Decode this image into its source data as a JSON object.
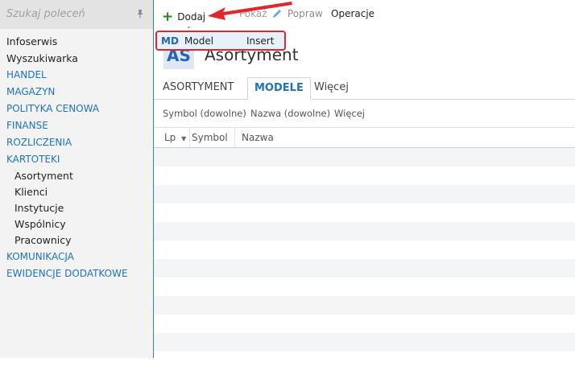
{
  "sidebar": {
    "search_placeholder": "Szukaj poleceń",
    "pin_icon": "pin-icon",
    "items": [
      {
        "label": "Infoserwis",
        "type": "item"
      },
      {
        "label": "Wyszukiwarka",
        "type": "item"
      },
      {
        "label": "HANDEL",
        "type": "section"
      },
      {
        "label": "MAGAZYN",
        "type": "section"
      },
      {
        "label": "POLITYKA CENOWA",
        "type": "section"
      },
      {
        "label": "FINANSE",
        "type": "section"
      },
      {
        "label": "ROZLICZENIA",
        "type": "section"
      },
      {
        "label": "KARTOTEKI",
        "type": "section"
      },
      {
        "label": "Asortyment",
        "type": "sub"
      },
      {
        "label": "Klienci",
        "type": "sub"
      },
      {
        "label": "Instytucje",
        "type": "sub"
      },
      {
        "label": "Wspólnicy",
        "type": "sub"
      },
      {
        "label": "Pracownicy",
        "type": "sub"
      },
      {
        "label": "KOMUNIKACJA",
        "type": "section"
      },
      {
        "label": "EWIDENCJE DODATKOWE",
        "type": "section"
      }
    ]
  },
  "toolbar": {
    "add_label": "Dodaj",
    "show_label": "Pokaż",
    "edit_label": "Popraw",
    "operations_label": "Operacje"
  },
  "dropdown": {
    "code": "MD",
    "label": "Model",
    "shortcut": "Insert"
  },
  "page": {
    "badge": "AS",
    "title": "Asortyment"
  },
  "tabs": {
    "tab1": "ASORTYMENT",
    "tab2": "MODELE",
    "tab3": "Więcej"
  },
  "filters": {
    "symbol": "Symbol (dowolne)",
    "name": "Nazwa (dowolne)",
    "more": "Więcej"
  },
  "grid": {
    "col_lp": "Lp",
    "col_symbol": "Symbol",
    "col_name": "Nazwa",
    "row_count": 12
  },
  "colors": {
    "accent": "#1d72c0",
    "highlight_border": "#e0262a",
    "add_icon": "#1f8a1f"
  }
}
